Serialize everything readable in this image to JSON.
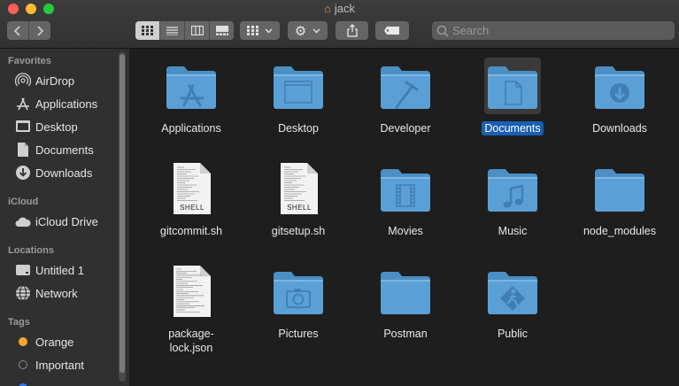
{
  "window": {
    "title": "jack"
  },
  "toolbar": {
    "search_placeholder": "Search"
  },
  "sidebar": {
    "sections": [
      {
        "title": "Favorites",
        "items": [
          {
            "label": "AirDrop",
            "icon": "airdrop-icon"
          },
          {
            "label": "Applications",
            "icon": "applications-icon"
          },
          {
            "label": "Desktop",
            "icon": "desktop-icon"
          },
          {
            "label": "Documents",
            "icon": "documents-icon"
          },
          {
            "label": "Downloads",
            "icon": "downloads-icon"
          }
        ]
      },
      {
        "title": "iCloud",
        "items": [
          {
            "label": "iCloud Drive",
            "icon": "cloud-icon"
          }
        ]
      },
      {
        "title": "Locations",
        "items": [
          {
            "label": "Untitled 1",
            "icon": "disk-icon"
          },
          {
            "label": "Network",
            "icon": "network-icon"
          }
        ]
      },
      {
        "title": "Tags",
        "items": [
          {
            "label": "Orange",
            "color": "#f7a530"
          },
          {
            "label": "Important",
            "color": "#888888"
          }
        ]
      }
    ]
  },
  "files": [
    {
      "name": "Applications",
      "type": "folder",
      "glyph": "apps"
    },
    {
      "name": "Desktop",
      "type": "folder",
      "glyph": "window"
    },
    {
      "name": "Developer",
      "type": "folder",
      "glyph": "hammer"
    },
    {
      "name": "Documents",
      "type": "folder",
      "glyph": "doc",
      "selected": true
    },
    {
      "name": "Downloads",
      "type": "folder",
      "glyph": "download"
    },
    {
      "name": "gitcommit.sh",
      "type": "shell",
      "badge": "SHELL"
    },
    {
      "name": "gitsetup.sh",
      "type": "shell",
      "badge": "SHELL"
    },
    {
      "name": "Movies",
      "type": "folder",
      "glyph": "film"
    },
    {
      "name": "Music",
      "type": "folder",
      "glyph": "note"
    },
    {
      "name": "node_modules",
      "type": "folder",
      "glyph": "none"
    },
    {
      "name": "package-\nlock.json",
      "type": "json"
    },
    {
      "name": "Pictures",
      "type": "folder",
      "glyph": "camera"
    },
    {
      "name": "Postman",
      "type": "folder",
      "glyph": "none"
    },
    {
      "name": "Public",
      "type": "folder",
      "glyph": "public"
    }
  ],
  "colors": {
    "folder": "#5aa0d6",
    "folder_tab": "#4b8fc4",
    "selection": "#1a5fb4"
  }
}
